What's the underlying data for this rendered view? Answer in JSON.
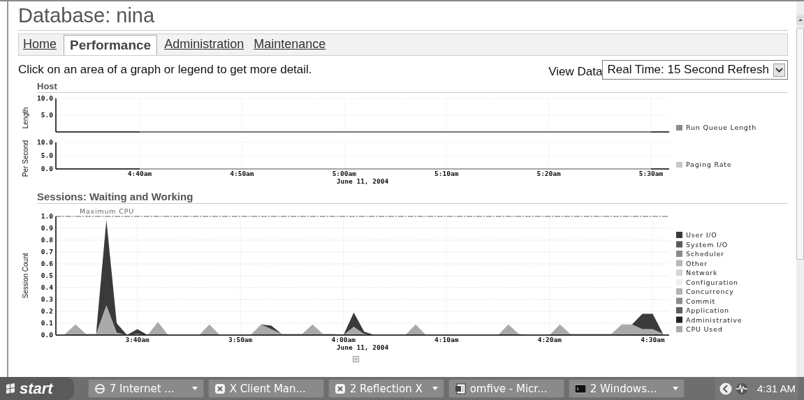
{
  "page": {
    "title": "Database: nina"
  },
  "tabs": [
    {
      "label": "Home",
      "selected": false
    },
    {
      "label": "Performance",
      "selected": true
    },
    {
      "label": "Administration",
      "selected": false
    },
    {
      "label": "Maintenance",
      "selected": false
    }
  ],
  "instructions": "Click on an area of a graph or legend to get more detail.",
  "view_data": {
    "label": "View Data",
    "value": "Real Time: 15 Second Refresh"
  },
  "host": {
    "heading": "Host",
    "charts": [
      {
        "chart_data": {
          "type": "line",
          "grid": true,
          "ylabel": "Length",
          "series": [
            {
              "name": "Run Queue Length",
              "color": "#8c8c8c",
              "values": [
                0,
                0,
                0,
                0,
                0,
                0
              ]
            }
          ],
          "ylim": [
            0,
            10
          ],
          "yticks": [
            {
              "value": 5,
              "label": "5.0"
            },
            {
              "value": 10,
              "label": "10.0"
            }
          ]
        }
      },
      {
        "chart_data": {
          "type": "line",
          "grid": true,
          "ylabel": "Per Second",
          "xlabel": "June 11, 2004",
          "categories": [
            "4:40am",
            "4:50am",
            "5:00am",
            "5:10am",
            "5:20am",
            "5:30am"
          ],
          "series": [
            {
              "name": "Paging Rate",
              "color": "#c8c8c8",
              "values": [
                0,
                0,
                0,
                0,
                0,
                0
              ]
            }
          ],
          "ylim": [
            0,
            10
          ],
          "yticks": [
            {
              "value": 0,
              "label": "0.0"
            },
            {
              "value": 5,
              "label": "5.0"
            },
            {
              "value": 10,
              "label": "10.0"
            }
          ]
        }
      }
    ]
  },
  "sessions": {
    "heading": "Sessions: Waiting and Working",
    "chart_data": {
      "type": "area",
      "stacked": true,
      "grid": true,
      "ylabel": "Session Count",
      "xlabel": "June 11, 2004",
      "annotations": [
        "Maximum CPU"
      ],
      "ylim": [
        0,
        1
      ],
      "yticks": [
        {
          "value": 0,
          "label": "0.0"
        },
        {
          "value": 0.1,
          "label": "0.1"
        },
        {
          "value": 0.2,
          "label": "0.2"
        },
        {
          "value": 0.3,
          "label": "0.3"
        },
        {
          "value": 0.4,
          "label": "0.4"
        },
        {
          "value": 0.5,
          "label": "0.5"
        },
        {
          "value": 0.6,
          "label": "0.6"
        },
        {
          "value": 0.7,
          "label": "0.7"
        },
        {
          "value": 0.8,
          "label": "0.8"
        },
        {
          "value": 0.9,
          "label": "0.9"
        },
        {
          "value": 1.0,
          "label": "1.0"
        }
      ],
      "categories": [
        null,
        null,
        null,
        null,
        null,
        null,
        null,
        "3:40am",
        null,
        null,
        null,
        null,
        null,
        null,
        null,
        null,
        null,
        "3:50am",
        null,
        null,
        null,
        null,
        null,
        null,
        null,
        null,
        null,
        "4:00am",
        null,
        null,
        null,
        null,
        null,
        null,
        null,
        null,
        null,
        "4:10am",
        null,
        null,
        null,
        null,
        null,
        null,
        null,
        null,
        null,
        "4:20am",
        null,
        null,
        null,
        null,
        null,
        null,
        null,
        null,
        null,
        "4:30am",
        null
      ],
      "series": [
        {
          "name": "CPU Used",
          "color": "#aaaaaa",
          "values": [
            0.01,
            0.09,
            0.01,
            0.01,
            0.25,
            0.02,
            0,
            0.01,
            0,
            0.11,
            0,
            0,
            0,
            0,
            0.09,
            0,
            0,
            0,
            0,
            0.09,
            0.05,
            0.01,
            0.01,
            0.01,
            0.09,
            0.01,
            0.01,
            0,
            0.07,
            0.01,
            0,
            0,
            0,
            0,
            0.09,
            0,
            0,
            0,
            0,
            0,
            0,
            0,
            0,
            0.09,
            0.01,
            0,
            0,
            0,
            0.09,
            0.01,
            0.01,
            0.01,
            0.01,
            0.01,
            0.09,
            0.09,
            0.05,
            0.05,
            0.01
          ]
        },
        {
          "name": "Administrative",
          "color": "#222222",
          "values": [
            null,
            null,
            null,
            null,
            null,
            null,
            null,
            null,
            null,
            null,
            null,
            null,
            null,
            null,
            null,
            null,
            null,
            null,
            null,
            null,
            null,
            null,
            null,
            null,
            null,
            null,
            null,
            null,
            null,
            null,
            null,
            null,
            null,
            null,
            null,
            null,
            null,
            null,
            null,
            null,
            null,
            null,
            null,
            null,
            null,
            null,
            null,
            null,
            null,
            null,
            null,
            null,
            null,
            null,
            null,
            null,
            null,
            null,
            null
          ]
        },
        {
          "name": "Application",
          "color": "#5e5e5e",
          "values": [
            null,
            null,
            null,
            null,
            null,
            null,
            null,
            null,
            null,
            null,
            null,
            null,
            null,
            null,
            null,
            null,
            null,
            null,
            null,
            null,
            null,
            null,
            null,
            null,
            null,
            null,
            null,
            null,
            null,
            null,
            null,
            null,
            null,
            null,
            null,
            null,
            null,
            null,
            null,
            null,
            null,
            null,
            null,
            null,
            null,
            null,
            null,
            null,
            null,
            null,
            null,
            null,
            null,
            null,
            null,
            null,
            null,
            null,
            null
          ]
        },
        {
          "name": "Commit",
          "color": "#8c8c8c",
          "values": [
            null,
            null,
            null,
            null,
            null,
            null,
            null,
            null,
            null,
            null,
            null,
            null,
            null,
            null,
            null,
            null,
            null,
            null,
            null,
            null,
            null,
            null,
            null,
            null,
            null,
            null,
            null,
            null,
            null,
            null,
            null,
            null,
            null,
            null,
            null,
            null,
            null,
            null,
            null,
            null,
            null,
            null,
            null,
            null,
            null,
            null,
            null,
            null,
            null,
            null,
            null,
            null,
            null,
            null,
            null,
            null,
            null,
            null,
            null
          ]
        },
        {
          "name": "Concurrency",
          "color": "#b4b4b4",
          "values": [
            null,
            null,
            null,
            null,
            null,
            null,
            null,
            null,
            null,
            null,
            null,
            null,
            null,
            null,
            null,
            null,
            null,
            null,
            null,
            null,
            null,
            null,
            null,
            null,
            null,
            null,
            null,
            null,
            null,
            null,
            null,
            null,
            null,
            null,
            null,
            null,
            null,
            null,
            null,
            null,
            null,
            null,
            null,
            null,
            null,
            null,
            null,
            null,
            null,
            null,
            null,
            null,
            null,
            null,
            null,
            null,
            null,
            null,
            null
          ]
        },
        {
          "name": "Configuration",
          "color": "#eeeeee",
          "values": [
            null,
            null,
            null,
            null,
            null,
            null,
            null,
            null,
            null,
            null,
            null,
            null,
            null,
            null,
            null,
            null,
            null,
            null,
            null,
            null,
            null,
            null,
            null,
            null,
            null,
            null,
            null,
            null,
            null,
            null,
            null,
            null,
            null,
            null,
            null,
            null,
            null,
            null,
            null,
            null,
            null,
            null,
            null,
            null,
            null,
            null,
            null,
            null,
            null,
            null,
            null,
            null,
            null,
            null,
            null,
            null,
            null,
            null,
            null
          ]
        },
        {
          "name": "Network",
          "color": "#d4d4d4",
          "values": [
            null,
            null,
            null,
            null,
            null,
            null,
            null,
            null,
            null,
            null,
            null,
            null,
            null,
            null,
            null,
            null,
            null,
            null,
            null,
            null,
            null,
            null,
            null,
            null,
            null,
            null,
            null,
            null,
            null,
            null,
            null,
            null,
            null,
            null,
            null,
            null,
            null,
            null,
            null,
            null,
            null,
            null,
            null,
            null,
            null,
            null,
            null,
            null,
            null,
            null,
            null,
            null,
            null,
            null,
            null,
            null,
            null,
            null,
            null
          ]
        },
        {
          "name": "Other",
          "color": "#b8b8b8",
          "values": [
            null,
            null,
            null,
            null,
            null,
            null,
            null,
            null,
            null,
            null,
            null,
            null,
            null,
            null,
            null,
            null,
            null,
            null,
            null,
            null,
            null,
            null,
            null,
            null,
            null,
            null,
            null,
            null,
            null,
            null,
            null,
            null,
            null,
            null,
            null,
            null,
            null,
            null,
            null,
            null,
            null,
            null,
            null,
            null,
            null,
            null,
            null,
            null,
            null,
            null,
            null,
            null,
            null,
            null,
            null,
            null,
            null,
            null,
            null
          ]
        },
        {
          "name": "Scheduler",
          "color": "#8a8a8a",
          "values": [
            null,
            null,
            null,
            null,
            null,
            null,
            null,
            null,
            null,
            null,
            null,
            null,
            null,
            null,
            null,
            null,
            null,
            null,
            null,
            null,
            null,
            null,
            null,
            null,
            null,
            null,
            null,
            null,
            null,
            null,
            null,
            null,
            null,
            null,
            null,
            null,
            null,
            null,
            null,
            null,
            null,
            null,
            null,
            null,
            null,
            null,
            null,
            null,
            null,
            null,
            null,
            null,
            null,
            null,
            null,
            null,
            null,
            null,
            null
          ]
        },
        {
          "name": "System I/O",
          "color": "#5a5a5a",
          "values": [
            null,
            null,
            null,
            null,
            null,
            null,
            null,
            null,
            null,
            null,
            null,
            null,
            null,
            null,
            null,
            null,
            null,
            null,
            null,
            null,
            null,
            null,
            null,
            null,
            null,
            null,
            null,
            null,
            null,
            null,
            null,
            null,
            null,
            null,
            null,
            null,
            null,
            null,
            null,
            null,
            null,
            null,
            null,
            null,
            null,
            null,
            null,
            null,
            null,
            null,
            null,
            null,
            null,
            null,
            null,
            null,
            null,
            null,
            null
          ]
        },
        {
          "name": "User I/O",
          "color": "#3a3a3a",
          "values": [
            0,
            0,
            0,
            0,
            0.72,
            0.08,
            0,
            0.04,
            0,
            0,
            0,
            0,
            0,
            0,
            0,
            0,
            0,
            0,
            0,
            0,
            0.03,
            0,
            0,
            0,
            0,
            0,
            0,
            0,
            0.12,
            0.02,
            0,
            0,
            0,
            0,
            0,
            0,
            0,
            0,
            0,
            0,
            0,
            0,
            0,
            0,
            0,
            0,
            0,
            0,
            0,
            0,
            0,
            0,
            0,
            0,
            0,
            0,
            0.13,
            0.13,
            0
          ]
        }
      ],
      "legend": true
    }
  },
  "taskbar": {
    "start": "start",
    "items": [
      {
        "label": "7 Internet ...",
        "kind": "browser",
        "grouped": true
      },
      {
        "label": "X Client Man...",
        "kind": "x",
        "grouped": false
      },
      {
        "label": "2 Reflection X",
        "kind": "x",
        "grouped": true
      },
      {
        "label": "omfive - Micr...",
        "kind": "doc",
        "grouped": false
      },
      {
        "label": "2 Windows...",
        "kind": "console",
        "grouped": true
      }
    ],
    "clock": "4:31 AM"
  }
}
